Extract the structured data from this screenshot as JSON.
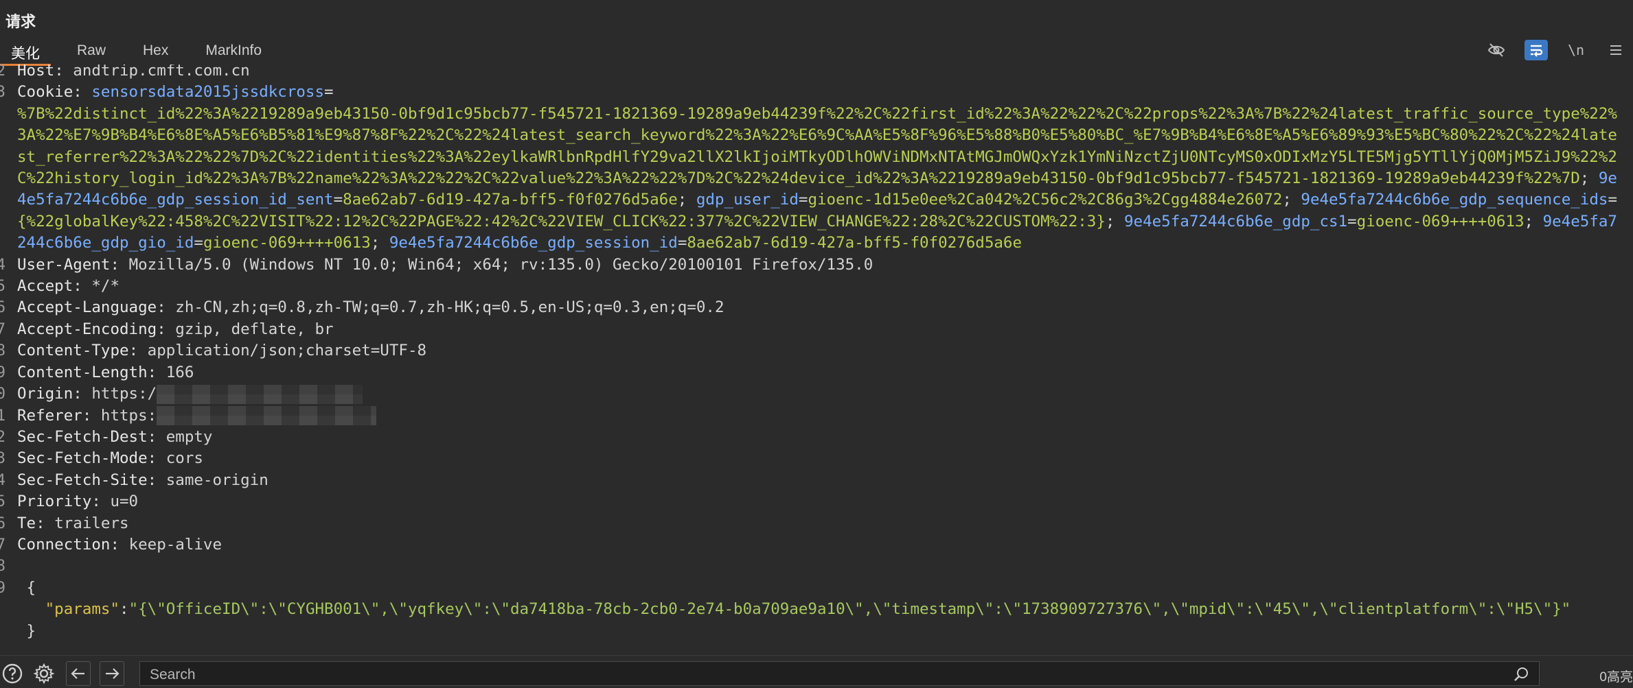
{
  "title": "请求",
  "tabs": [
    {
      "label": "美化",
      "active": true
    },
    {
      "label": "Raw"
    },
    {
      "label": "Hex"
    },
    {
      "label": "MarkInfo"
    }
  ],
  "toolbar": {
    "newline_label": "\\n",
    "icons": [
      "eye-off-icon",
      "wrap-icon",
      "newline-icon",
      "menu-icon"
    ]
  },
  "lines": {
    "l2": {
      "num": "2",
      "name": "Host",
      "value": "andtrip.cmft.com.cn"
    },
    "l3": {
      "num": "3",
      "name": "Cookie"
    },
    "l4": {
      "num": "4",
      "name": "User-Agent",
      "value": "Mozilla/5.0 (Windows NT 10.0; Win64; x64; rv:135.0) Gecko/20100101 Firefox/135.0"
    },
    "l5": {
      "num": "5",
      "name": "Accept",
      "value": "*/*"
    },
    "l6": {
      "num": "6",
      "name": "Accept-Language",
      "value": "zh-CN,zh;q=0.8,zh-TW;q=0.7,zh-HK;q=0.5,en-US;q=0.3,en;q=0.2"
    },
    "l7": {
      "num": "7",
      "name": "Accept-Encoding",
      "value": "gzip, deflate, br"
    },
    "l8": {
      "num": "8",
      "name": "Content-Type",
      "value": "application/json;charset=UTF-8"
    },
    "l9": {
      "num": "9",
      "name": "Content-Length",
      "value": "166"
    },
    "l10": {
      "num": "0",
      "name": "Origin",
      "value": "https:/"
    },
    "l11": {
      "num": "1",
      "name": "Referer",
      "value": "https:"
    },
    "l12": {
      "num": "2",
      "name": "Sec-Fetch-Dest",
      "value": "empty"
    },
    "l13": {
      "num": "3",
      "name": "Sec-Fetch-Mode",
      "value": "cors"
    },
    "l14": {
      "num": "4",
      "name": "Sec-Fetch-Site",
      "value": "same-origin"
    },
    "l15": {
      "num": "5",
      "name": "Priority",
      "value": "u=0"
    },
    "l16": {
      "num": "6",
      "name": "Te",
      "value": "trailers"
    },
    "l17": {
      "num": "7",
      "name": "Connection",
      "value": "keep-alive"
    },
    "l18": {
      "num": "8"
    },
    "l19": {
      "num": "9",
      "brace_open": "{",
      "brace_close": "}",
      "json_key": "\"params\"",
      "json_value": "\"{\\\"OfficeID\\\":\\\"CYGHB001\\\",\\\"yqfkey\\\":\\\"da7418ba-78cb-2cb0-2e74-b0a709ae9a10\\\",\\\"timestamp\\\":\\\"1738909727376\\\",\\\"mpid\\\":\\\"45\\\",\\\"clientplatform\\\":\\\"H5\\\"}\""
    }
  },
  "cookies": [
    {
      "name": "sensorsdata2015jssdkcross",
      "value": "%7B%22distinct_id%22%3A%2219289a9eb43150-0bf9d1c95bcb77-f545721-1821369-19289a9eb44239f%22%2C%22first_id%22%3A%22%22%2C%22props%22%3A%7B%22%24latest_traffic_source_type%22%3A%22%E7%9B%B4%E6%8E%A5%E6%B5%81%E9%87%8F%22%2C%22%24latest_search_keyword%22%3A%22%E6%9C%AA%E5%8F%96%E5%88%B0%E5%80%BC_%E7%9B%B4%E6%8E%A5%E6%89%93%E5%BC%80%22%2C%22%24latest_referrer%22%3A%22%22%7D%2C%22identities%22%3A%22eylkaWRlbnRpdHlfY29va2llX2lkIjoiMTkyODlhOWViNDMxNTAtMGJmOWQxYzk1YmNiNzctZjU0NTcyMS0xODIxMzY5LTE5Mjg5YTllYjQ0MjM5ZiJ9%22%2C%22history_login_id%22%3A%7B%22name%22%3A%22%22%2C%22value%22%3A%22%22%7D%2C%22%24device_id%22%3A%2219289a9eb43150-0bf9d1c95bcb77-f545721-1821369-19289a9eb44239f%22%7D"
    },
    {
      "name": "9e4e5fa7244c6b6e_gdp_session_id_sent",
      "value": "8ae62ab7-6d19-427a-bff5-f0f0276d5a6e"
    },
    {
      "name": "gdp_user_id",
      "value": "gioenc-1d15e0ee%2Ca042%2C56c2%2C86g3%2Cgg4884e26072"
    },
    {
      "name": "9e4e5fa7244c6b6e_gdp_sequence_ids",
      "value": "{%22globalKey%22:458%2C%22VISIT%22:12%2C%22PAGE%22:42%2C%22VIEW_CLICK%22:377%2C%22VIEW_CHANGE%22:28%2C%22CUSTOM%22:3}"
    },
    {
      "name": "9e4e5fa7244c6b6e_gdp_cs1",
      "value": "gioenc-069++++0613"
    },
    {
      "name": "9e4e5fa7244c6b6e_gdp_gio_id",
      "value": "gioenc-069++++0613"
    },
    {
      "name": "9e4e5fa7244c6b6e_gdp_session_id",
      "value": "8ae62ab7-6d19-427a-bff5-f0f0276d5a6e"
    }
  ],
  "bottom": {
    "search_placeholder": "Search",
    "highlight_count": "0高亮"
  }
}
